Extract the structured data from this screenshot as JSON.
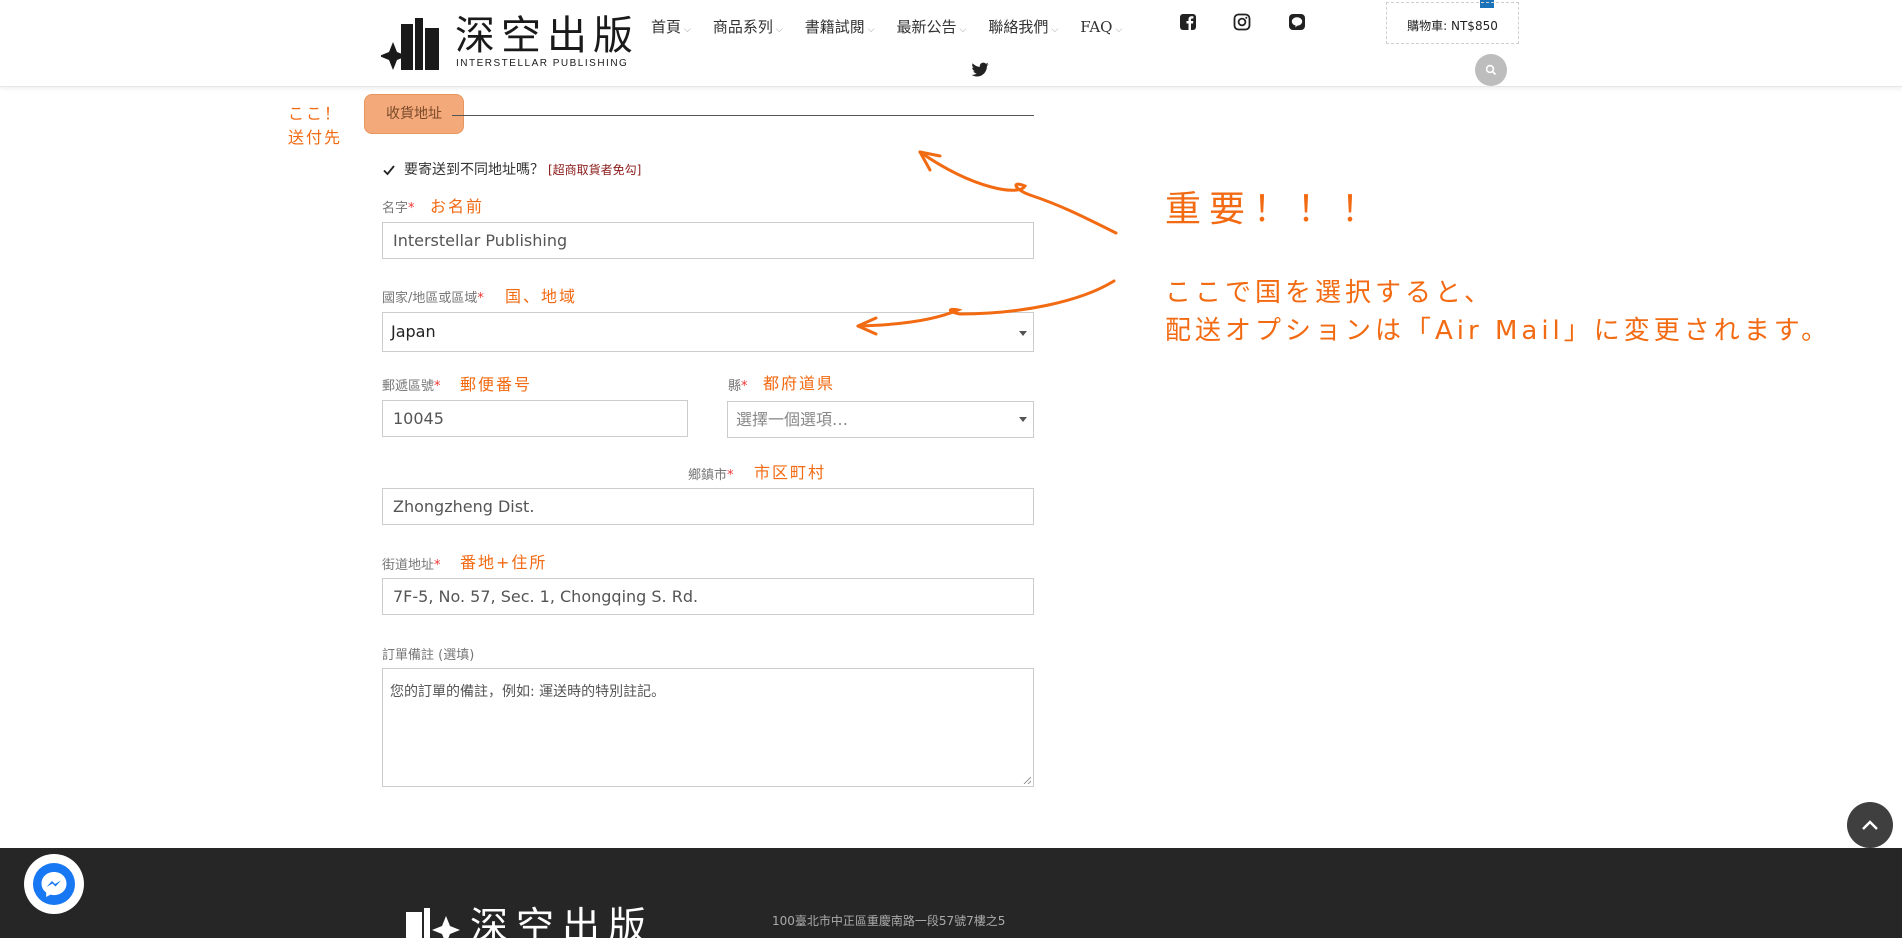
{
  "header": {
    "logo_cn": "深空出版",
    "logo_en": "INTERSTELLAR PUBLISHING",
    "nav": [
      "首頁",
      "商品系列",
      "書籍試閱",
      "最新公告",
      "聯絡我們",
      "FAQ"
    ],
    "cart_label": "購物車: NT$850",
    "social_icons": [
      "facebook-icon",
      "instagram-icon",
      "line-icon",
      "twitter-icon"
    ]
  },
  "form": {
    "section_title": "收貨地址",
    "ship_different_label": "要寄送到不同地址嗎？",
    "ship_different_note": "[超商取貨者免勾]",
    "ship_different_checked": true,
    "name": {
      "label": "名字",
      "required": "*",
      "value": "Interstellar Publishing"
    },
    "country": {
      "label": "國家/地區或區域",
      "required": "*",
      "value": "Japan"
    },
    "postcode": {
      "label": "郵遞區號",
      "required": "*",
      "value": "10045"
    },
    "state": {
      "label": "縣",
      "required": "*",
      "placeholder": "選擇一個選項…"
    },
    "city": {
      "label": "鄉鎮市",
      "required": "*",
      "value": "Zhongzheng Dist."
    },
    "street": {
      "label": "街道地址",
      "required": "*",
      "value": "7F-5, No. 57, Sec. 1, Chongqing S. Rd."
    },
    "notes": {
      "label": "訂單備註 (選填)",
      "placeholder": "您的訂單的備註，例如: 運送時的特別註記。"
    }
  },
  "annotations": {
    "koko_line1": "ここ！",
    "koko_line2": "送付先",
    "name": "お名前",
    "country": "国、地域",
    "postcode": "郵便番号",
    "state": "都府道県",
    "city": "市区町村",
    "street": "番地+住所",
    "important": "重要！！！",
    "note_line1": "ここで国を選択すると、",
    "note_line2": "配送オプションは「Air Mail」に変更されます。"
  },
  "footer": {
    "logo_cn": "深空出版",
    "address": "100臺北市中正區重慶南路一段57號7樓之5"
  },
  "colors": {
    "annotation": "#f26a12",
    "section_tab_bg": "#f4a97a",
    "footer_bg": "#262626",
    "required": "#ee3333",
    "messenger": "#1877f2"
  }
}
